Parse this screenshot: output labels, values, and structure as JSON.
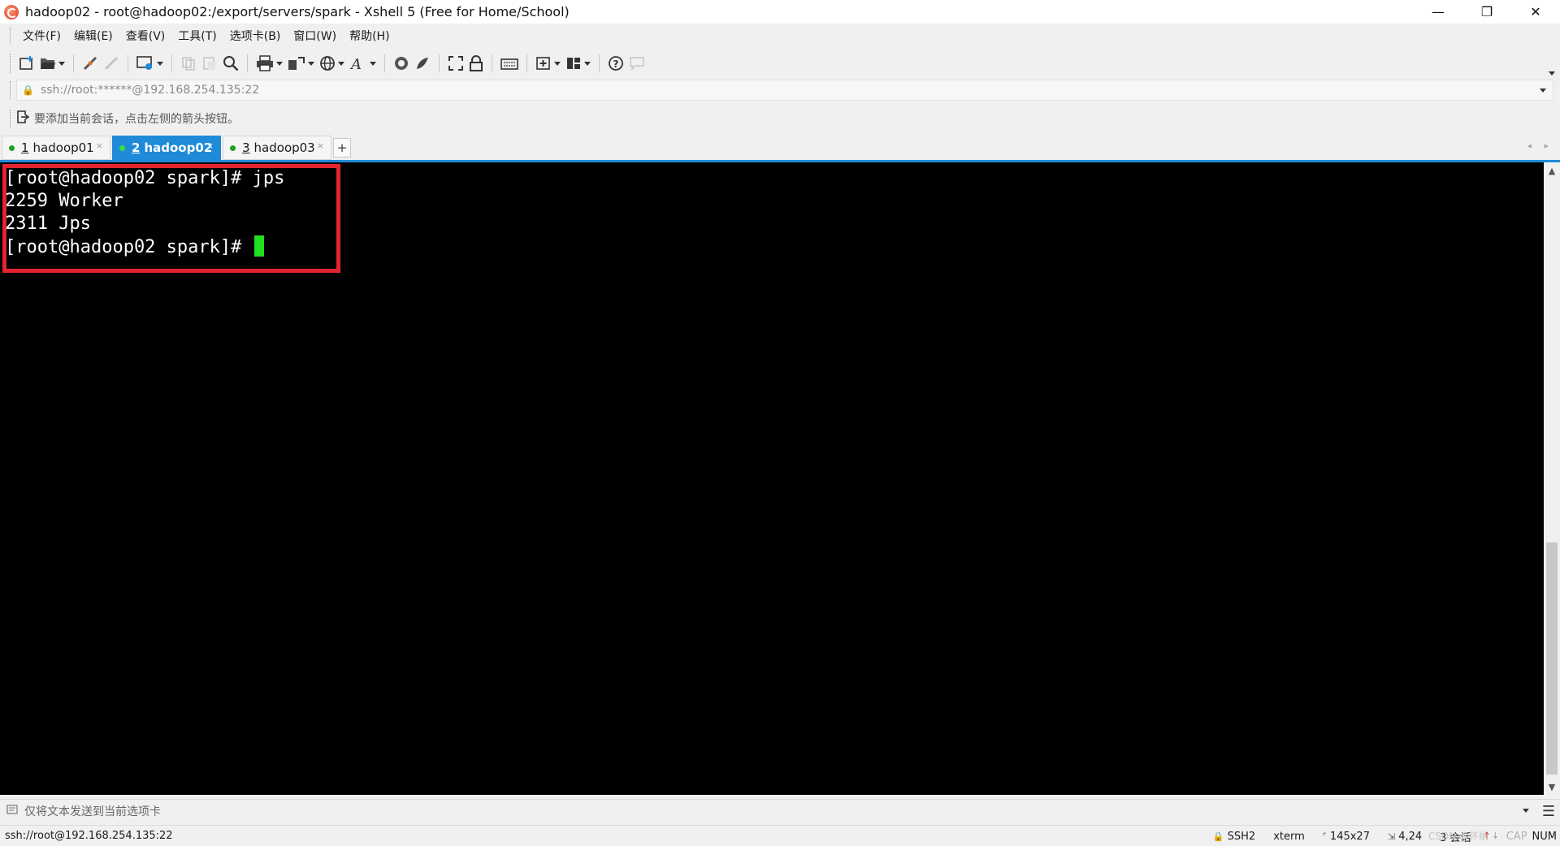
{
  "window": {
    "title": "hadoop02 - root@hadoop02:/export/servers/spark - Xshell 5 (Free for Home/School)",
    "minimize": "—",
    "restore": "❐",
    "close": "✕"
  },
  "menu": [
    {
      "label": "文件(F)"
    },
    {
      "label": "编辑(E)"
    },
    {
      "label": "查看(V)"
    },
    {
      "label": "工具(T)"
    },
    {
      "label": "选项卡(B)"
    },
    {
      "label": "窗口(W)"
    },
    {
      "label": "帮助(H)"
    }
  ],
  "address_bar": {
    "value": "ssh://root:******@192.168.254.135:22"
  },
  "session_hint": {
    "text": "要添加当前会话，点击左侧的箭头按钮。"
  },
  "tabs": [
    {
      "num": "1",
      "label": "hadoop01",
      "active": false,
      "close": "×"
    },
    {
      "num": "2",
      "label": "hadoop02",
      "active": true,
      "close": "×"
    },
    {
      "num": "3",
      "label": "hadoop03",
      "active": false,
      "close": "×"
    }
  ],
  "tab_add": "+",
  "tab_nav": "◂ ▸",
  "terminal": {
    "lines": [
      "[root@hadoop02 spark]# jps",
      "2259 Worker",
      "2311 Jps",
      "[root@hadoop02 spark]# "
    ],
    "cursor_color": "#1ee01e",
    "highlight_color": "#e2252f"
  },
  "scrollbar": {
    "up": "▲",
    "down": "▼"
  },
  "compose_bar": {
    "text": "仅将文本发送到当前选项卡"
  },
  "status_bar": {
    "connection": "ssh://root@192.168.254.135:22",
    "protocol": "SSH2",
    "terminal_type": "xterm",
    "size": "145x27",
    "cursor_pos": "4,24",
    "sessions": "3 会话",
    "caps": "CAP",
    "num": "NUM",
    "watermark": "CSDN @怀纳"
  },
  "colors": {
    "accent_blue": "#1f8ad8",
    "status_green": "#1aa321"
  }
}
